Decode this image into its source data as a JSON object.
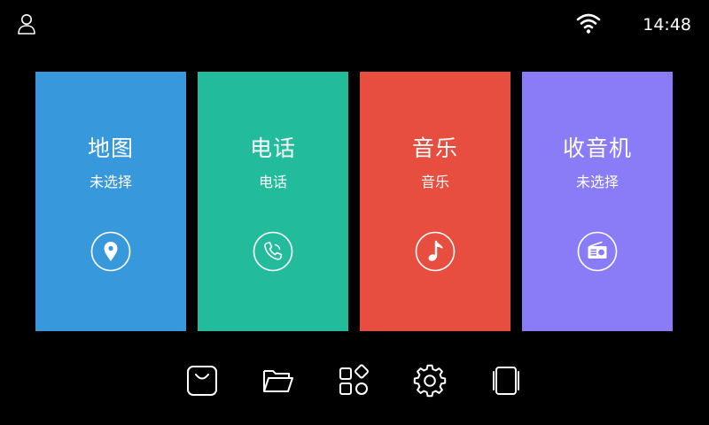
{
  "status_bar": {
    "user_icon": "user-icon",
    "wifi_icon": "wifi-icon",
    "time": "14:48"
  },
  "tiles": [
    {
      "title": "地图",
      "subtitle": "未选择",
      "icon": "map-pin-icon",
      "color": "#3898DC"
    },
    {
      "title": "电话",
      "subtitle": "电话",
      "icon": "phone-icon",
      "color": "#22BC9C"
    },
    {
      "title": "音乐",
      "subtitle": "音乐",
      "icon": "music-note-icon",
      "color": "#E74E3F"
    },
    {
      "title": "收音机",
      "subtitle": "未选择",
      "icon": "radio-icon",
      "color": "#8A7BF6"
    }
  ],
  "dock": [
    {
      "icon": "shopping-bag-icon"
    },
    {
      "icon": "folder-icon"
    },
    {
      "icon": "apps-icon"
    },
    {
      "icon": "settings-icon"
    },
    {
      "icon": "screen-mirror-icon"
    }
  ]
}
